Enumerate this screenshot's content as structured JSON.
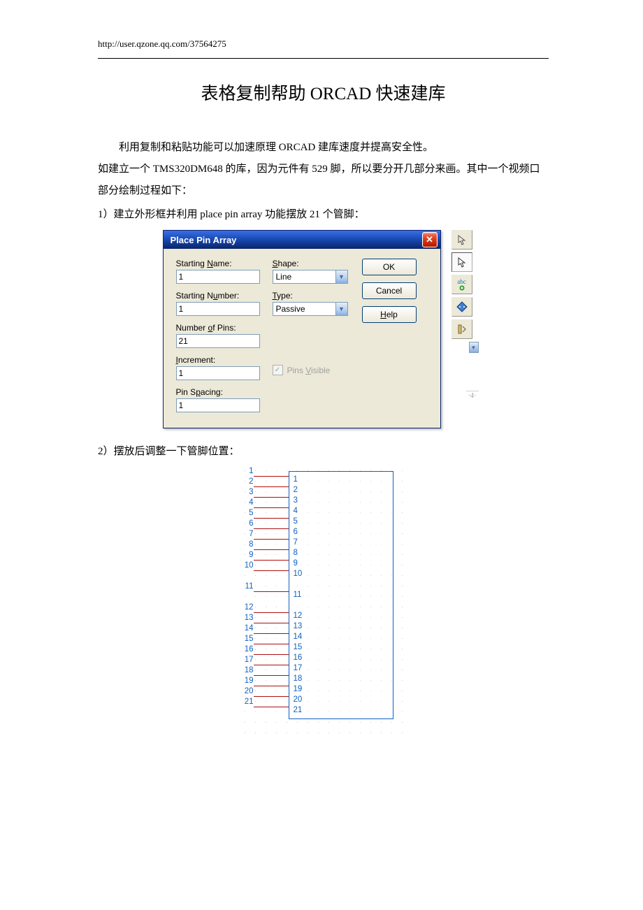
{
  "header_link": "http://user.qzone.qq.com/37564275",
  "title": "表格复制帮助 ORCAD 快速建库",
  "para1": "利用复制和粘贴功能可以加速原理 ORCAD 建库速度并提高安全性。",
  "para2": "如建立一个 TMS320DM648 的库，因为元件有 529 脚，所以要分开几部分来画。其中一个视频口部分绘制过程如下：",
  "item1": "1）建立外形框并利用 place pin array 功能摆放 21 个管脚：",
  "item2": "2）摆放后调整一下管脚位置：",
  "dialog": {
    "title": "Place Pin Array",
    "starting_name_label_pre": "Starting ",
    "starting_name_label_u": "N",
    "starting_name_label_post": "ame:",
    "starting_name_value": "1",
    "starting_number_label_pre": "Starting N",
    "starting_number_label_u": "u",
    "starting_number_label_post": "mber:",
    "starting_number_value": "1",
    "number_of_pins_label_pre": "Number ",
    "number_of_pins_label_u": "o",
    "number_of_pins_label_post": "f Pins:",
    "number_of_pins_value": "21",
    "increment_label_u": "I",
    "increment_label_post": "ncrement:",
    "increment_value": "1",
    "pin_spacing_label_pre": "Pin S",
    "pin_spacing_label_u": "p",
    "pin_spacing_label_post": "acing:",
    "pin_spacing_value": "1",
    "shape_label_u": "S",
    "shape_label_post": "hape:",
    "shape_value": "Line",
    "type_label_u": "T",
    "type_label_post": "ype:",
    "type_value": "Passive",
    "pins_visible_pre": "Pins ",
    "pins_visible_u": "V",
    "pins_visible_post": "isible",
    "ok_label": "OK",
    "cancel_label": "Cancel",
    "help_label_u": "H",
    "help_label_post": "elp"
  },
  "side": {
    "grid_hint": "·4·",
    "abc_label": "abc"
  },
  "pins": {
    "group1": [
      "1",
      "2",
      "3",
      "4",
      "5",
      "6",
      "7",
      "8",
      "9",
      "10"
    ],
    "solo": "11",
    "group2": [
      "12",
      "13",
      "14",
      "15",
      "16",
      "17",
      "18",
      "19",
      "20",
      "21"
    ],
    "names1": [
      "1",
      "2",
      "3",
      "4",
      "5",
      "6",
      "7",
      "8",
      "9",
      "10"
    ],
    "name_solo": "11",
    "names2": [
      "12",
      "13",
      "14",
      "15",
      "16",
      "17",
      "18",
      "19",
      "20",
      "21"
    ]
  }
}
